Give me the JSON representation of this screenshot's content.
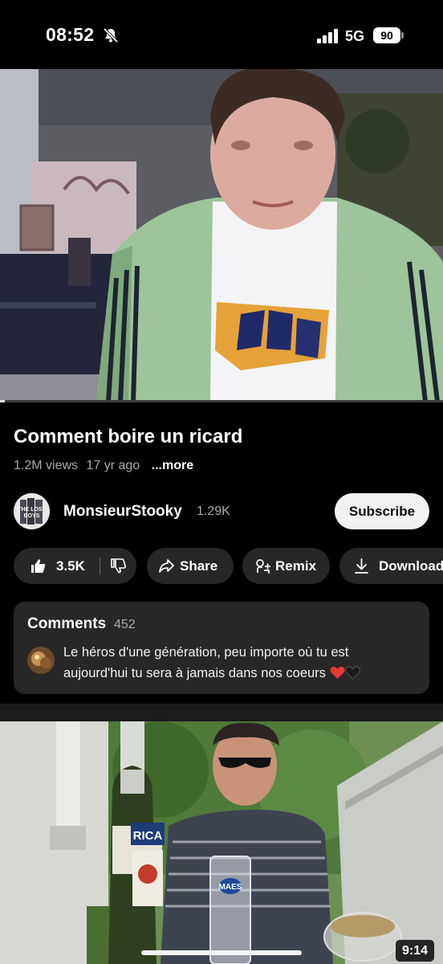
{
  "status_bar": {
    "time": "08:52",
    "network": "5G",
    "battery": "90",
    "icons": [
      "bell-slash-icon",
      "signal-icon"
    ]
  },
  "player": {
    "progress_fraction": 0.01
  },
  "video": {
    "title": "Comment boire un ricard",
    "views": "1.2M views",
    "age": "17 yr ago",
    "more_label": "...more"
  },
  "channel": {
    "name": "MonsieurStooky",
    "subscribers": "1.29K",
    "subscribe_label": "Subscribe",
    "avatar_text": "THE LOST BOYS"
  },
  "actions": {
    "likes": "3.5K",
    "share_label": "Share",
    "remix_label": "Remix",
    "download_label": "Download",
    "icons": [
      "thumbs-up-icon",
      "thumbs-down-icon",
      "share-icon",
      "remix-icon",
      "download-icon"
    ]
  },
  "comments": {
    "title": "Comments",
    "count": "452",
    "top_comment": "Le héros d'une génération, peu importe où tu est aujourd'hui tu sera à jamais dans nos coeurs",
    "emoji": [
      "red-heart-icon",
      "black-heart-icon"
    ]
  },
  "next_video": {
    "duration": "9:14",
    "bottle_label": "RICA",
    "glass_label": "MAES"
  },
  "colors": {
    "background": "#000000",
    "pill": "#272727",
    "secondary_text": "#aaaaaa",
    "subscribe_bg": "#f1f1f1",
    "heart": "#e53935"
  }
}
